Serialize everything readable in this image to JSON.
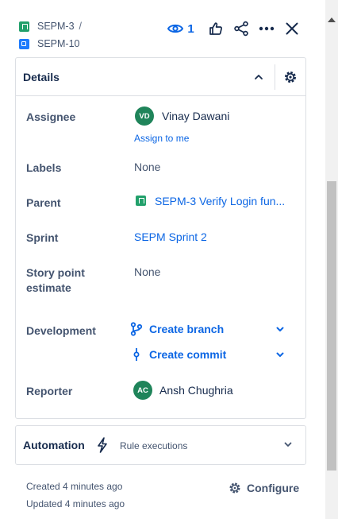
{
  "breadcrumb": {
    "parent_key": "SEPM-3",
    "separator": "/",
    "current_key": "SEPM-10"
  },
  "header": {
    "watch_count": "1"
  },
  "details": {
    "title": "Details",
    "fields": {
      "assignee_label": "Assignee",
      "assignee_initials": "VD",
      "assignee_name": "Vinay Dawani",
      "assign_to_me": "Assign to me",
      "labels_label": "Labels",
      "labels_value": "None",
      "parent_label": "Parent",
      "parent_value": "SEPM-3 Verify Login fun...",
      "sprint_label": "Sprint",
      "sprint_value": "SEPM Sprint 2",
      "story_points_label_line1": "Story point",
      "story_points_label_line2": "estimate",
      "story_points_value": "None",
      "development_label": "Development",
      "create_branch": "Create branch",
      "create_commit": "Create commit",
      "reporter_label": "Reporter",
      "reporter_initials": "AC",
      "reporter_name": "Ansh Chughria"
    }
  },
  "automation": {
    "title": "Automation",
    "subtitle": "Rule executions"
  },
  "footer": {
    "created": "Created 4 minutes ago",
    "updated": "Updated 4 minutes ago",
    "configure": "Configure"
  },
  "colors": {
    "link": "#0c66e4",
    "story": "#22a06b",
    "subtask": "#1d7afc",
    "avatar": "#1f845a"
  }
}
